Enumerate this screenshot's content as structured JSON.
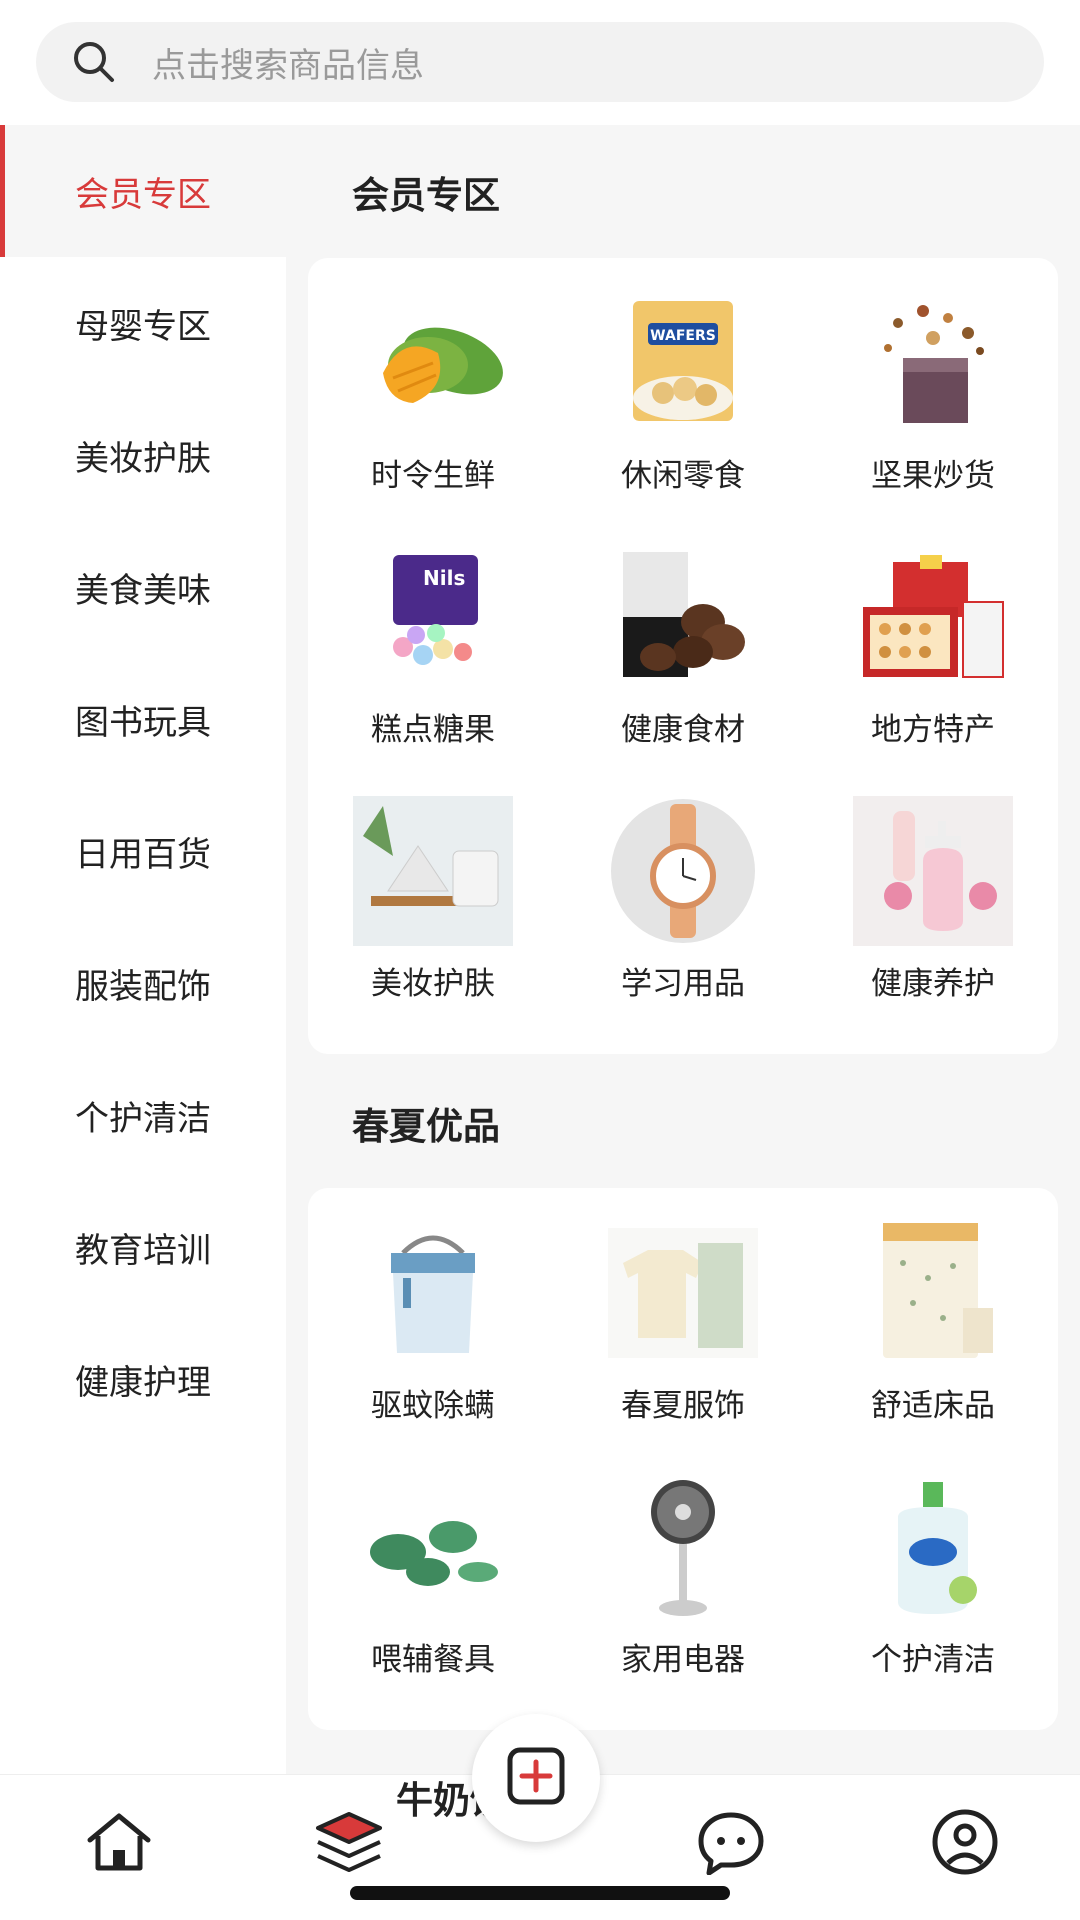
{
  "search": {
    "placeholder": "点击搜索商品信息"
  },
  "sidebar": {
    "items": [
      {
        "label": "会员专区",
        "active": true
      },
      {
        "label": "母婴专区"
      },
      {
        "label": "美妆护肤"
      },
      {
        "label": "美食美味"
      },
      {
        "label": "图书玩具"
      },
      {
        "label": "日用百货"
      },
      {
        "label": "服装配饰"
      },
      {
        "label": "个护清洁"
      },
      {
        "label": "教育培训"
      },
      {
        "label": "健康护理"
      }
    ]
  },
  "sections": [
    {
      "title": "会员专区",
      "items": [
        {
          "label": "时令生鲜",
          "icon": "mango-icon"
        },
        {
          "label": "休闲零食",
          "icon": "wafers-snack-icon"
        },
        {
          "label": "坚果炒货",
          "icon": "nuts-box-icon"
        },
        {
          "label": "糕点糖果",
          "icon": "candy-bag-icon"
        },
        {
          "label": "健康食材",
          "icon": "mushroom-icon"
        },
        {
          "label": "地方特产",
          "icon": "gift-box-icon"
        },
        {
          "label": "美妆护肤",
          "icon": "cotton-pads-icon"
        },
        {
          "label": "学习用品",
          "icon": "wristwatch-icon"
        },
        {
          "label": "健康养护",
          "icon": "lotion-bottle-icon"
        }
      ]
    },
    {
      "title": "春夏优品",
      "items": [
        {
          "label": "驱蚊除螨",
          "icon": "mite-remover-icon"
        },
        {
          "label": "春夏服饰",
          "icon": "clothes-icon"
        },
        {
          "label": "舒适床品",
          "icon": "bedding-icon"
        },
        {
          "label": "喂辅餐具",
          "icon": "cookware-icon"
        },
        {
          "label": "家用电器",
          "icon": "standing-fan-icon"
        },
        {
          "label": "个护清洁",
          "icon": "body-wash-icon"
        }
      ]
    }
  ],
  "peek_title": "牛奶饮",
  "bottom_nav": [
    {
      "name": "home",
      "icon": "home-icon"
    },
    {
      "name": "category",
      "icon": "category-layers-icon",
      "active": true
    },
    {
      "name": "publish",
      "icon": "plus-square-icon"
    },
    {
      "name": "messages",
      "icon": "chat-bubble-icon"
    },
    {
      "name": "profile",
      "icon": "profile-icon"
    }
  ],
  "colors": {
    "accent": "#d83a3a",
    "background": "#f6f6f6",
    "panel": "#ffffff"
  }
}
